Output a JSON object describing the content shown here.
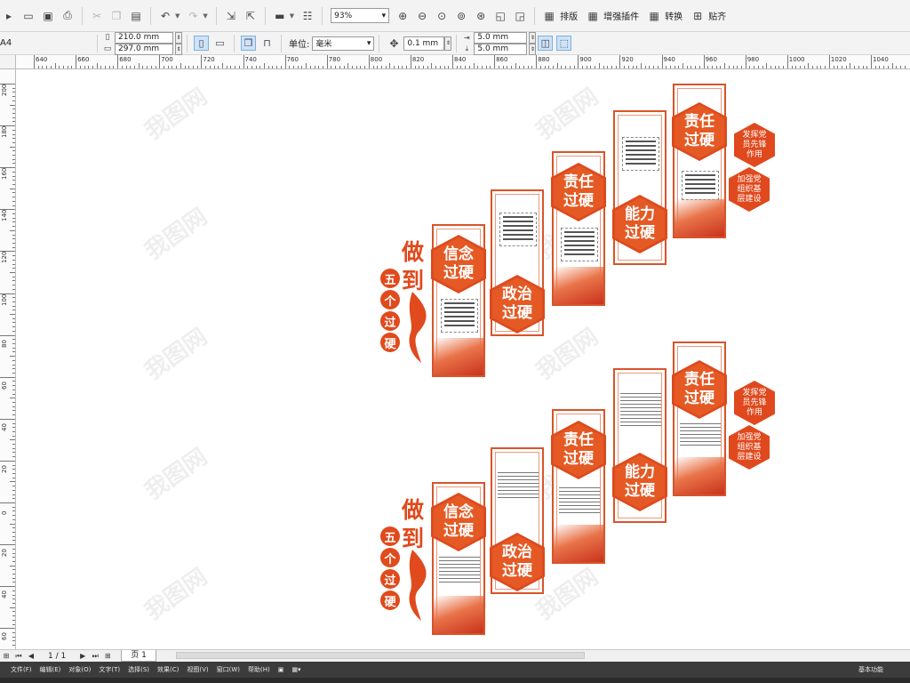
{
  "toolbar": {
    "zoom": "93%",
    "menus": [
      "排版",
      "增强插件",
      "转换",
      "贴齐"
    ]
  },
  "propbar": {
    "preset": "A4",
    "width": "210.0 mm",
    "height": "297.0 mm",
    "units_label": "单位:",
    "units_value": "毫米",
    "nudge": "0.1 mm",
    "dup_x": "5.0 mm",
    "dup_y": "5.0 mm"
  },
  "ruler": {
    "h_ticks": [
      "640",
      "660",
      "680",
      "700",
      "720",
      "740",
      "760",
      "780",
      "800",
      "820",
      "840",
      "860",
      "880",
      "900",
      "920",
      "940",
      "960",
      "980",
      "1000",
      "1020",
      "1040"
    ],
    "v_ticks": [
      "200",
      "180",
      "160",
      "140",
      "120",
      "100",
      "80",
      "60",
      "40",
      "20",
      "0",
      "20",
      "40",
      "60"
    ]
  },
  "design": {
    "banner_chars": [
      "做",
      "到"
    ],
    "circle_chars": [
      "五",
      "个",
      "过",
      "硬"
    ],
    "hex_labels": [
      "信念\n过硬",
      "政治\n过硬",
      "责任\n过硬",
      "能力\n过硬",
      "责任\n过硬"
    ],
    "side_labels": [
      "发挥党\n员先锋\n作用",
      "加强党\n组织基\n层建设"
    ],
    "watermark": "我图网"
  },
  "pagenav": {
    "page_count": "1 / 1",
    "page_tab": "页 1"
  },
  "menubar": {
    "items": [
      "文件(F)",
      "编辑(E)",
      "对象(O)",
      "文字(T)",
      "选择(S)",
      "效果(C)",
      "视图(V)",
      "窗口(W)",
      "帮助(H)"
    ],
    "workspace": "基本功能"
  }
}
